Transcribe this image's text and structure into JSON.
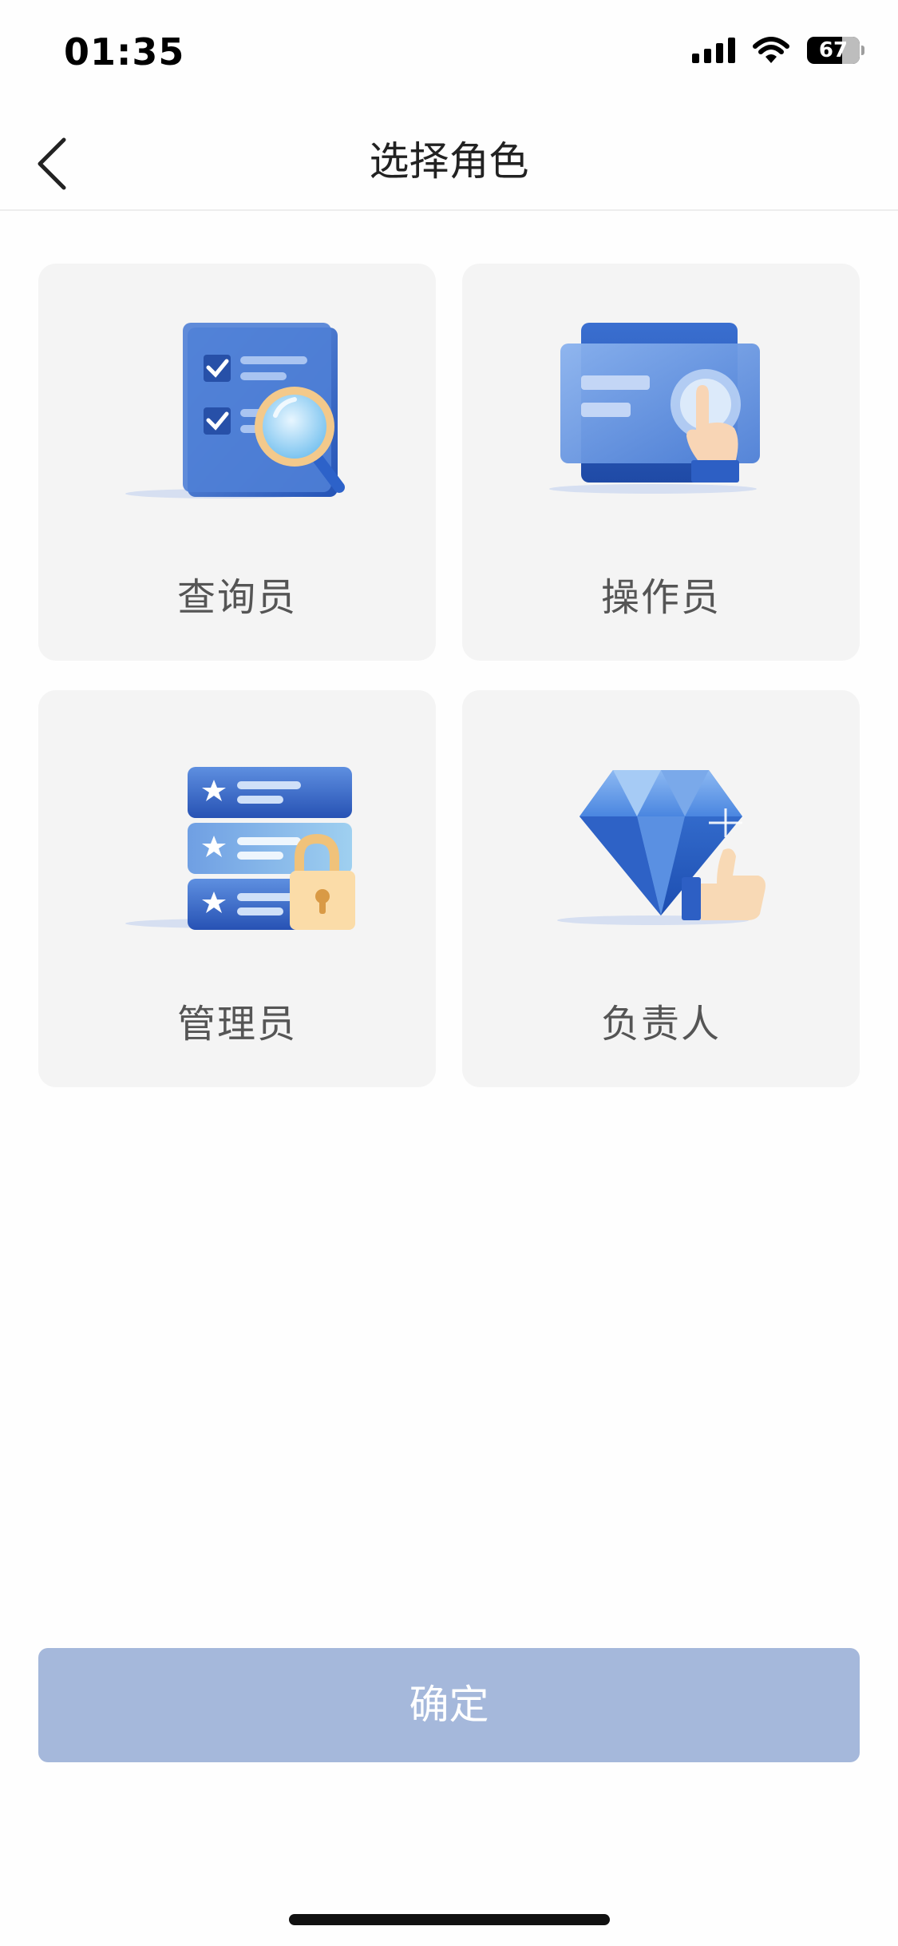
{
  "status_bar": {
    "time": "01:35",
    "battery": "67",
    "icons": [
      "signal-icon",
      "wifi-icon",
      "battery-icon"
    ]
  },
  "nav": {
    "title": "选择角色",
    "back_icon": "chevron-left-icon"
  },
  "roles": [
    {
      "label": "查询员",
      "icon": "checklist-search-icon"
    },
    {
      "label": "操作员",
      "icon": "touch-screen-icon"
    },
    {
      "label": "管理员",
      "icon": "locked-list-icon"
    },
    {
      "label": "负责人",
      "icon": "diamond-thumbsup-icon"
    }
  ],
  "confirm": {
    "label": "确定"
  },
  "colors": {
    "accent_blue": "#2c5fc4",
    "card_bg": "#f4f4f4",
    "button_disabled": "#a5b8db"
  }
}
